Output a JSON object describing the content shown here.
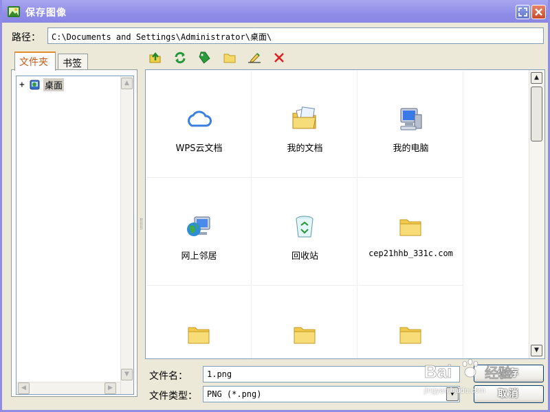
{
  "window": {
    "title": "保存图像"
  },
  "path": {
    "label": "路径：",
    "value": "C:\\Documents and Settings\\Administrator\\桌面\\"
  },
  "tabs": [
    {
      "label": "文件夹",
      "active": true
    },
    {
      "label": "书签",
      "active": false
    }
  ],
  "tree": {
    "expander": "+",
    "root_label": "桌面"
  },
  "toolbar": {
    "buttons": [
      {
        "icon": "folder-up-icon"
      },
      {
        "icon": "refresh-icon"
      },
      {
        "icon": "bookmark-tag-icon"
      },
      {
        "icon": "new-folder-icon"
      },
      {
        "icon": "rename-icon"
      },
      {
        "icon": "delete-icon"
      }
    ]
  },
  "files": [
    {
      "label": "WPS云文档",
      "icon": "cloud-icon"
    },
    {
      "label": "我的文档",
      "icon": "my-documents-icon"
    },
    {
      "label": "我的电脑",
      "icon": "my-computer-icon"
    },
    {
      "label": "网上邻居",
      "icon": "network-places-icon"
    },
    {
      "label": "回收站",
      "icon": "recycle-bin-icon"
    },
    {
      "label": "cep21hhb_331c.com",
      "icon": "folder-icon"
    },
    {
      "label": "",
      "icon": "folder-icon"
    },
    {
      "label": "",
      "icon": "folder-icon"
    },
    {
      "label": "",
      "icon": "folder-icon"
    }
  ],
  "filename": {
    "label": "文件名：",
    "value": "1.png"
  },
  "filetype": {
    "label": "文件类型：",
    "value": "PNG (*.png)"
  },
  "buttons": {
    "save": "保存",
    "cancel": "取消"
  },
  "watermark": {
    "brand": "Bai",
    "brand2": "经验",
    "url": "jingyan.baidu.com"
  },
  "colors": {
    "title_bar": "#908de8",
    "active_tab": "#e68b2c",
    "delete": "#e02020",
    "refresh": "#1f9a3a"
  }
}
